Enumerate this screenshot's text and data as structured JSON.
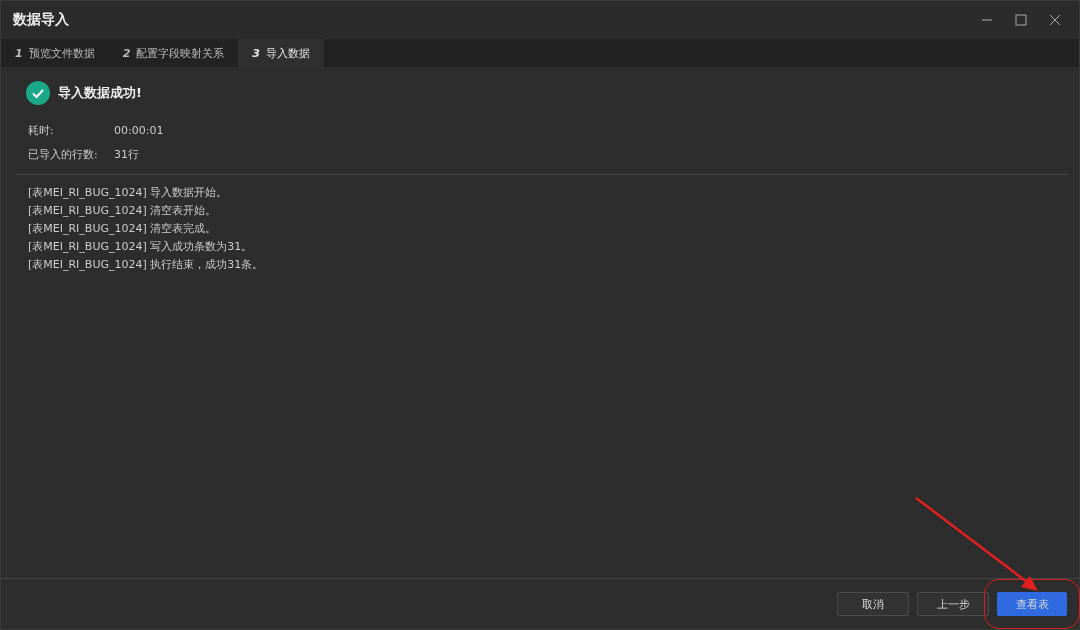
{
  "window": {
    "title": "数据导入"
  },
  "tabs": [
    {
      "number": "1",
      "label": "预览文件数据",
      "selected": false
    },
    {
      "number": "2",
      "label": "配置字段映射关系",
      "selected": false
    },
    {
      "number": "3",
      "label": "导入数据",
      "selected": true
    }
  ],
  "result": {
    "message": "导入数据成功!",
    "fields": [
      {
        "label": "耗时:",
        "value": "00:00:01"
      },
      {
        "label": "已导入的行数:",
        "value": "31行"
      }
    ]
  },
  "log": [
    "[表MEI_RI_BUG_1024] 导入数据开始。",
    "[表MEI_RI_BUG_1024] 清空表开始。",
    "[表MEI_RI_BUG_1024] 清空表完成。",
    "[表MEI_RI_BUG_1024] 写入成功条数为31。",
    "[表MEI_RI_BUG_1024] 执行结束，成功31条。"
  ],
  "buttons": [
    {
      "label": "取消",
      "primary": false,
      "highlighted": false
    },
    {
      "label": "上一步",
      "primary": false,
      "highlighted": false
    },
    {
      "label": "查看表",
      "primary": true,
      "highlighted": true
    }
  ]
}
